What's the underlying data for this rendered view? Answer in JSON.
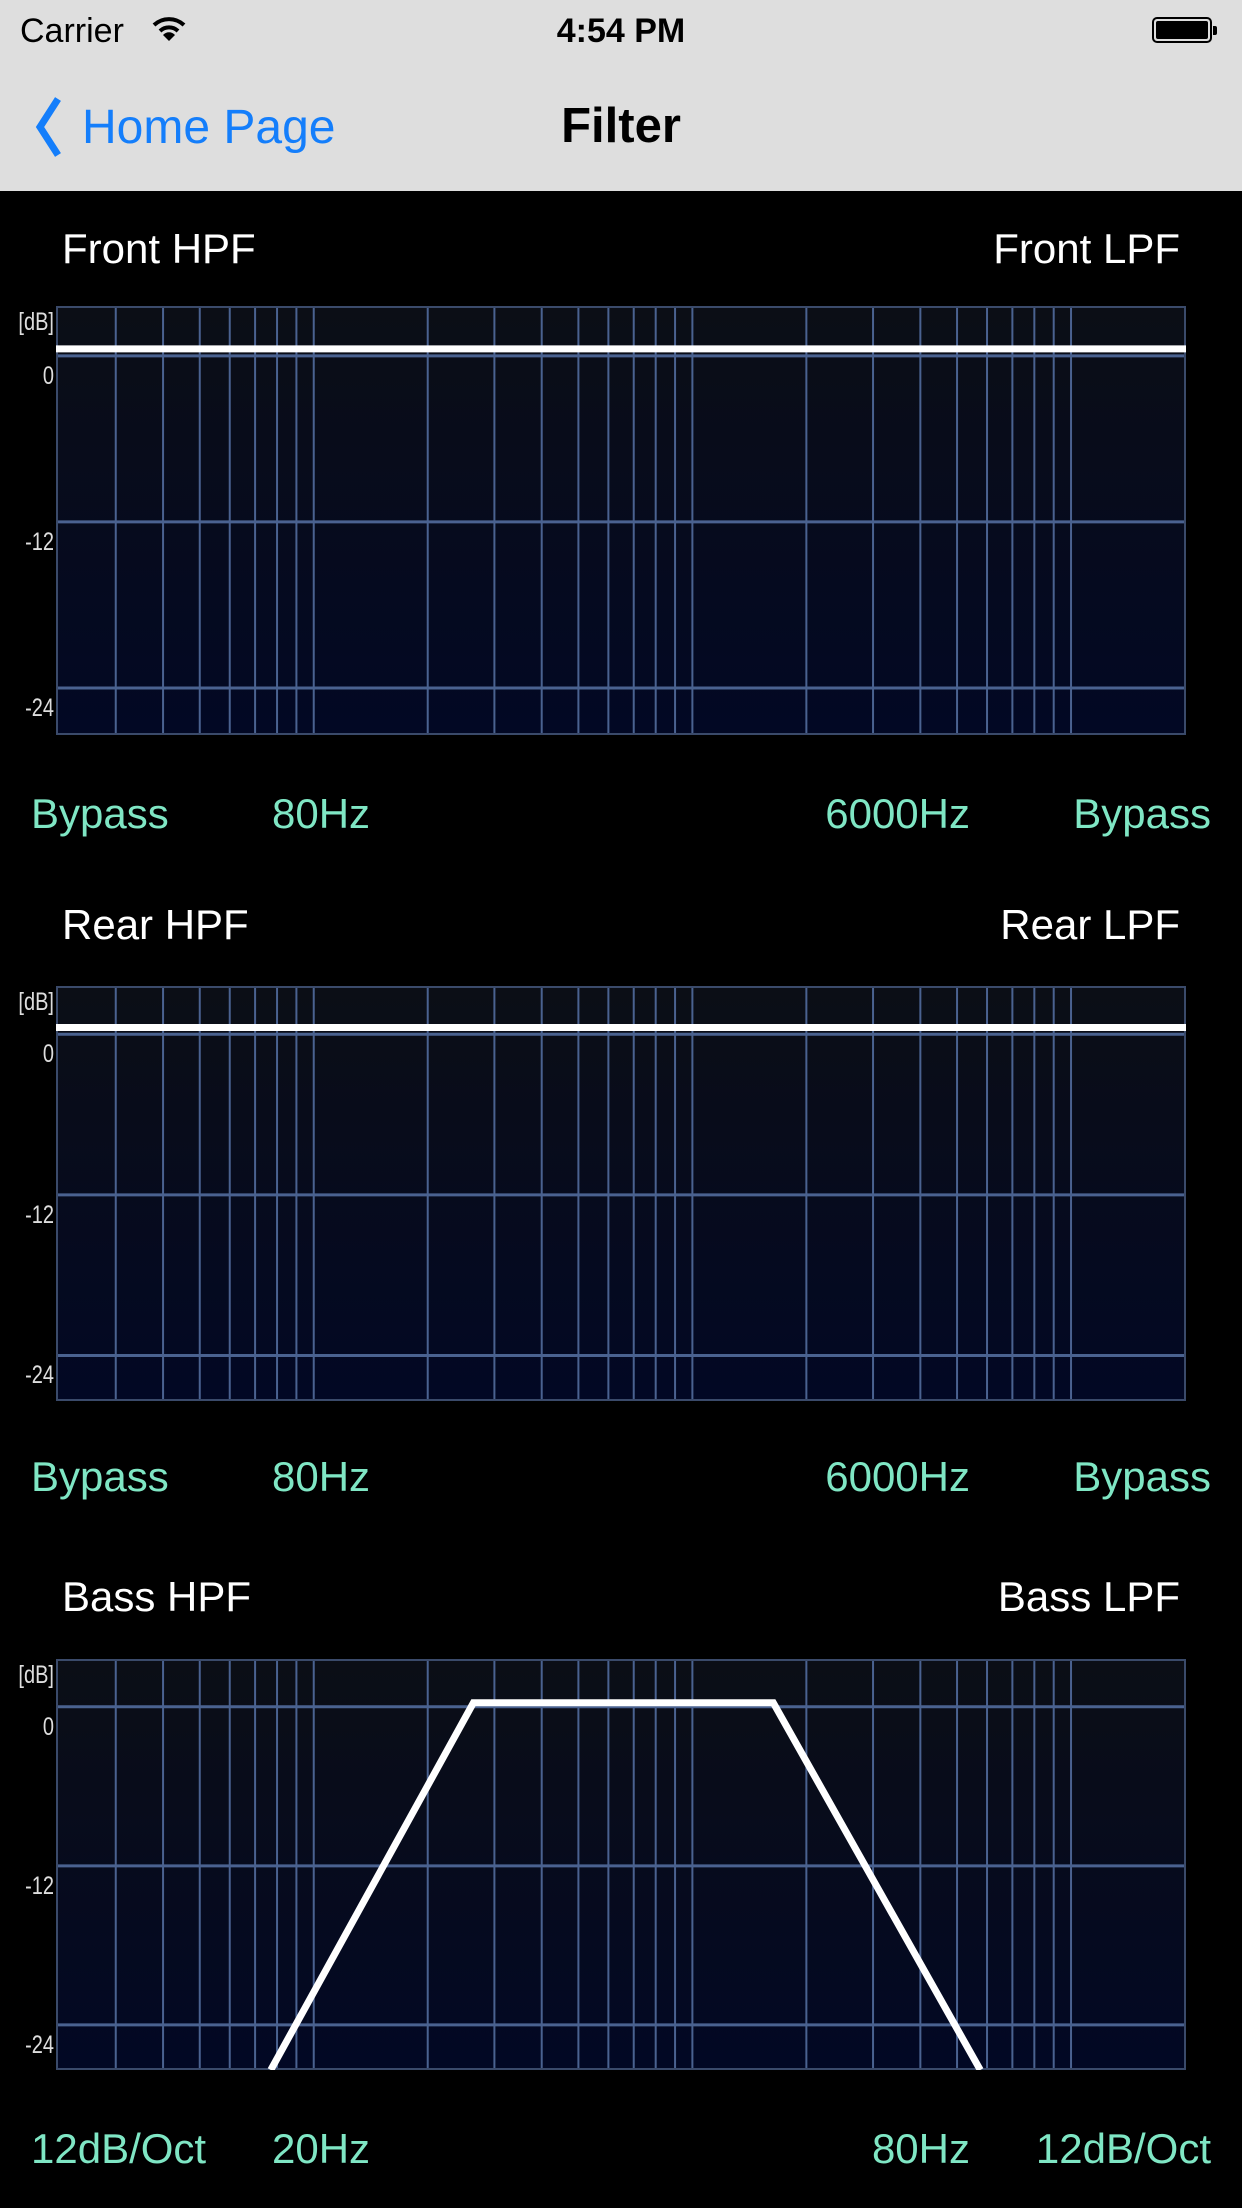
{
  "status_bar": {
    "carrier": "Carrier",
    "time": "4:54 PM",
    "wifi_icon": "wifi-icon",
    "battery_icon": "battery-icon"
  },
  "nav": {
    "back_label": "Home Page",
    "title": "Filter"
  },
  "colors": {
    "accent": "#147efb",
    "value_text": "#7fe6c4",
    "grid": "#4a6290",
    "curve": "#ffffff"
  },
  "y_axis": {
    "unit": "[dB]",
    "ticks": [
      "0",
      "-12",
      "-24"
    ]
  },
  "chart_data": [
    {
      "type": "line",
      "left_title": "Front HPF",
      "right_title": "Front LPF",
      "hpf_slope": "Bypass",
      "hpf_freq": "80Hz",
      "lpf_freq": "6000Hz",
      "lpf_slope": "Bypass",
      "xscale": "log",
      "xlim": [
        10.43,
        10060
      ],
      "ylim": [
        -27.4,
        3.6
      ],
      "grid": true,
      "grid_x": [
        15,
        20,
        25,
        30,
        35,
        40,
        45,
        50,
        100,
        150,
        200,
        250,
        300,
        350,
        400,
        450,
        500,
        1000,
        1500,
        2000,
        2500,
        3000,
        3500,
        4000,
        4500,
        5000
      ],
      "grid_y": [
        0,
        -12,
        -24
      ],
      "points": [
        [
          10.43,
          0.5
        ],
        [
          10060,
          0.5
        ]
      ]
    },
    {
      "type": "line",
      "left_title": "Rear HPF",
      "right_title": "Rear LPF",
      "hpf_slope": "Bypass",
      "hpf_freq": "80Hz",
      "lpf_freq": "6000Hz",
      "lpf_slope": "Bypass",
      "xscale": "log",
      "xlim": [
        10.43,
        10060
      ],
      "ylim": [
        -27.4,
        3.6
      ],
      "grid": true,
      "grid_x": [
        15,
        20,
        25,
        30,
        35,
        40,
        45,
        50,
        100,
        150,
        200,
        250,
        300,
        350,
        400,
        450,
        500,
        1000,
        1500,
        2000,
        2500,
        3000,
        3500,
        4000,
        4500,
        5000
      ],
      "grid_y": [
        0,
        -12,
        -24
      ],
      "points": [
        [
          10.43,
          0.5
        ],
        [
          10060,
          0.5
        ]
      ]
    },
    {
      "type": "line",
      "left_title": "Bass HPF",
      "right_title": "Bass LPF",
      "hpf_slope": "12dB/Oct",
      "hpf_freq": "20Hz",
      "lpf_freq": "80Hz",
      "lpf_slope": "12dB/Oct",
      "xscale": "log",
      "xlim": [
        10.43,
        10060
      ],
      "ylim": [
        -27.4,
        3.6
      ],
      "grid": true,
      "grid_x": [
        15,
        20,
        25,
        30,
        35,
        40,
        45,
        50,
        100,
        150,
        200,
        250,
        300,
        350,
        400,
        450,
        500,
        1000,
        1500,
        2000,
        2500,
        3000,
        3500,
        4000,
        4500,
        5000
      ],
      "grid_y": [
        0,
        -12,
        -24
      ],
      "points": [
        [
          38.5,
          -27.4
        ],
        [
          132,
          0.3
        ],
        [
          818,
          0.3
        ],
        [
          2880,
          -27.4
        ]
      ]
    }
  ]
}
